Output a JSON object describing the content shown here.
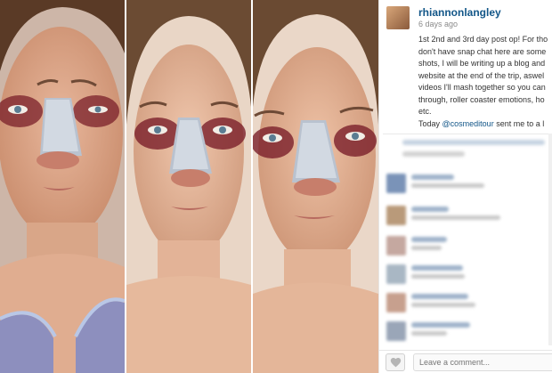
{
  "post": {
    "username": "rhiannonlangley",
    "time_ago": "6 days ago",
    "caption_lines": [
      "1st 2nd and 3rd day post op! For tho",
      "don't have snap chat here are some",
      "shots, I will be writing up a blog and",
      "website at the end of the trip, aswel",
      "videos I'll mash together so you can",
      "through, roller coaster emotions, ho",
      "etc."
    ],
    "caption_last_prefix": "Today ",
    "caption_mention": "@cosmeditour",
    "caption_last_suffix": " sent me to a l"
  },
  "footer": {
    "comment_placeholder": "Leave a comment..."
  },
  "icons": {
    "like": "heart-icon"
  },
  "colors": {
    "username": "#125688",
    "mention": "#125688",
    "bruise": "#7a1f2a"
  }
}
